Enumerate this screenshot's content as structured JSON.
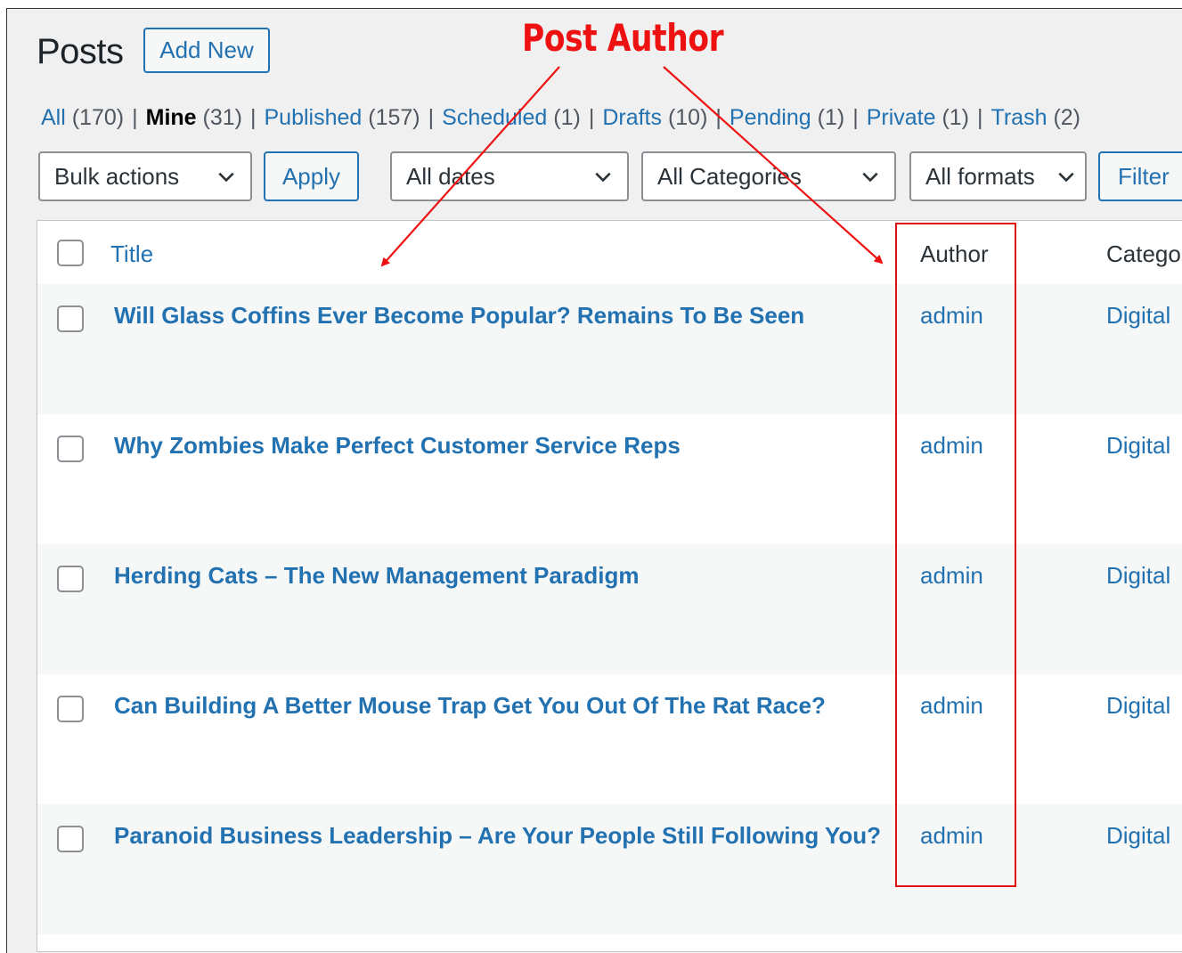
{
  "header": {
    "title": "Posts",
    "add_new_label": "Add New"
  },
  "filters": {
    "views": [
      {
        "label": "All",
        "count": "(170)",
        "current": false
      },
      {
        "label": "Mine",
        "count": "(31)",
        "current": true
      },
      {
        "label": "Published",
        "count": "(157)",
        "current": false
      },
      {
        "label": "Scheduled",
        "count": "(1)",
        "current": false
      },
      {
        "label": "Drafts",
        "count": "(10)",
        "current": false
      },
      {
        "label": "Pending",
        "count": "(1)",
        "current": false
      },
      {
        "label": "Private",
        "count": "(1)",
        "current": false
      },
      {
        "label": "Trash",
        "count": "(2)",
        "current": false
      }
    ],
    "separator": "|"
  },
  "toolbar": {
    "bulk_actions": "Bulk actions",
    "apply_label": "Apply",
    "dates": "All dates",
    "categories": "All Categories",
    "formats": "All formats",
    "filter_label": "Filter"
  },
  "table": {
    "columns": {
      "title": "Title",
      "author": "Author",
      "categories": "Catego"
    },
    "rows": [
      {
        "title": "Will Glass Coffins Ever Become Popular? Remains To Be Seen",
        "author": "admin",
        "category": "Digital"
      },
      {
        "title": "Why Zombies Make Perfect Customer Service Reps",
        "author": "admin",
        "category": "Digital"
      },
      {
        "title": "Herding Cats – The New Management Paradigm",
        "author": "admin",
        "category": "Digital"
      },
      {
        "title": "Can Building A Better Mouse Trap Get You Out Of The Rat Race?",
        "author": "admin",
        "category": "Digital"
      },
      {
        "title": "Paranoid Business Leadership – Are Your People Still Following You?",
        "author": "admin",
        "category": "Digital"
      }
    ]
  },
  "annotation": {
    "label": "Post Author",
    "color": "#ee1111"
  },
  "colors": {
    "link": "#2271b1",
    "background": "#f0f0f1",
    "table_bg": "#ffffff",
    "alt_row": "#f6f7f7"
  }
}
